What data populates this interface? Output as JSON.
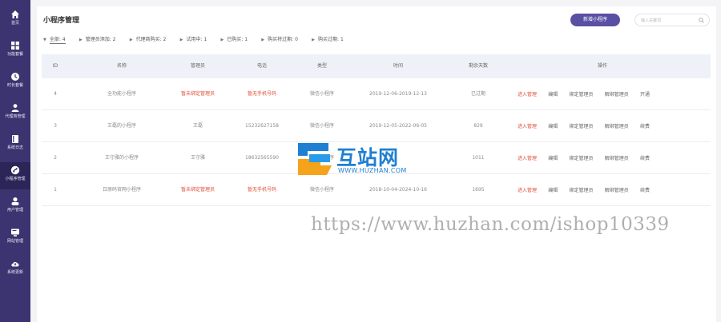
{
  "sidebar": {
    "items": [
      {
        "label": "首页",
        "icon": "home-icon"
      },
      {
        "label": "功能套餐",
        "icon": "grid-icon"
      },
      {
        "label": "时长套餐",
        "icon": "clock-icon"
      },
      {
        "label": "代理商管理",
        "icon": "agent-icon"
      },
      {
        "label": "系统日志",
        "icon": "log-icon"
      },
      {
        "label": "小程序管理",
        "icon": "miniapp-icon",
        "active": true
      },
      {
        "label": "用户管理",
        "icon": "user-icon"
      },
      {
        "label": "网站管理",
        "icon": "website-icon"
      },
      {
        "label": "系统更新",
        "icon": "cloud-update-icon"
      }
    ]
  },
  "header": {
    "title": "小程序管理",
    "new_button": "新增小程序",
    "search_placeholder": "输入关键词"
  },
  "filters": [
    {
      "label": "全部",
      "count": ": 4"
    },
    {
      "label": "管理员添加",
      "count": ": 2"
    },
    {
      "label": "代理商购买",
      "count": ": 2"
    },
    {
      "label": "试用中",
      "count": ": 1"
    },
    {
      "label": "已购买",
      "count": ": 1"
    },
    {
      "label": "购买将过期",
      "count": ": 0"
    },
    {
      "label": "购买过期",
      "count": ": 1"
    }
  ],
  "table": {
    "columns": [
      "ID",
      "名称",
      "管理员",
      "电话",
      "类型",
      "时间",
      "剩余天数",
      "操作"
    ],
    "rows": [
      {
        "id": "4",
        "name": "全功能小程序",
        "admin": "暂未绑定管理员",
        "admin_red": true,
        "phone": "暂无手机号码",
        "phone_red": true,
        "type": "微信小程序",
        "time": "2019-12-06-2019-12-13",
        "remaining": "已过期",
        "ops": [
          "进入管理",
          "编辑",
          "绑定管理员",
          "解绑管理员",
          "开通"
        ]
      },
      {
        "id": "3",
        "name": "王磊的小程序",
        "admin": "王磊",
        "admin_red": false,
        "phone": "15232627158",
        "phone_red": false,
        "type": "微信小程序",
        "time": "2019-12-05-2022-06-05",
        "remaining": "829",
        "ops": [
          "进入管理",
          "编辑",
          "绑定管理员",
          "解绑管理员",
          "续费"
        ]
      },
      {
        "id": "2",
        "name": "王守雅的小程序",
        "admin": "王守雅",
        "admin_red": false,
        "phone": "18632565590",
        "phone_red": false,
        "type": "微信小程序",
        "time": "",
        "remaining": "1011",
        "ops": [
          "进入管理",
          "编辑",
          "绑定管理员",
          "解绑管理员",
          "续费"
        ]
      },
      {
        "id": "1",
        "name": "日原码官网小程序",
        "admin": "暂未绑定管理员",
        "admin_red": true,
        "phone": "暂无手机号码",
        "phone_red": true,
        "type": "微信小程序",
        "time": "2018-10-04-2024-10-16",
        "remaining": "1695",
        "ops": [
          "进入管理",
          "编辑",
          "绑定管理员",
          "解绑管理员",
          "续费"
        ]
      }
    ]
  },
  "watermark": {
    "brand": "互站网",
    "url_small": "WWW.HUZHAN.COM",
    "url_big": "https://www.huzhan.com/ishop10339"
  },
  "colors": {
    "sidebar": "#3b3470",
    "accent": "#5a50a3",
    "danger": "#e0503a",
    "watermark_blue": "#1f7fd2"
  }
}
